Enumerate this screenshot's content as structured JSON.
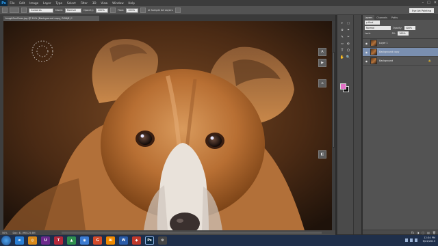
{
  "app": {
    "logo": "Ps",
    "menu": [
      "File",
      "Edit",
      "Image",
      "Layer",
      "Type",
      "Select",
      "Filter",
      "3D",
      "View",
      "Window",
      "Help"
    ],
    "window_controls": [
      "–",
      "□",
      "✕"
    ]
  },
  "options_bar": {
    "mode_value": "Contents",
    "opacity_label": "Mode:",
    "opacity_value": "Normal",
    "amount_label": "Opacity:",
    "amount_value": "100%",
    "flow_label": "Flow:",
    "flow_value": "100%",
    "sample_label": "Sample All Layers",
    "workspace": "Eye Art Painting"
  },
  "document": {
    "tab_title": "toughFoxClear.jpg @ 50% (Background copy, RGB/8) *",
    "zoom": "50%",
    "doc_size": "Doc: 41.9M/125.6M"
  },
  "float_buttons": [
    "A",
    "▶",
    "⌂",
    "◧"
  ],
  "tools": [
    "▸",
    "⬚",
    "ʘ",
    "⌖",
    "✎",
    "✂",
    "▭",
    "◐",
    "T",
    "⬠",
    "✋",
    "🔍"
  ],
  "colors": {
    "foreground": "#e36fc6",
    "background": "#111111"
  },
  "layers_panel": {
    "tabs": [
      "Layers",
      "Channels",
      "Paths"
    ],
    "kind": "ρ Kind",
    "blend_mode": "Normal",
    "opacity_label": "Opacity:",
    "opacity_value": "100%",
    "lock_label": "Lock:",
    "fill_label": "Fill:",
    "fill_value": "100%",
    "layers": [
      {
        "name": "Layer 1",
        "visible": true,
        "selected": false,
        "locked": false
      },
      {
        "name": "Background copy",
        "visible": true,
        "selected": true,
        "locked": false
      },
      {
        "name": "Background",
        "visible": true,
        "selected": false,
        "locked": true
      }
    ],
    "footer_icons": [
      "fx",
      "◑",
      "▢",
      "▤",
      "🗑"
    ]
  },
  "taskbar": {
    "apps": [
      {
        "label": "e",
        "color": "#2a7fd4"
      },
      {
        "label": "◎",
        "color": "#d98a1a"
      },
      {
        "label": "U",
        "color": "#6c2a8c"
      },
      {
        "label": "T",
        "color": "#b5283a"
      },
      {
        "label": "▲",
        "color": "#2f8f4f"
      },
      {
        "label": "◉",
        "color": "#3b7bd1"
      },
      {
        "label": "G",
        "color": "#d44a2a"
      },
      {
        "label": "Ai",
        "color": "#f08a00"
      },
      {
        "label": "W",
        "color": "#2a5ba8"
      },
      {
        "label": "◆",
        "color": "#c0392b"
      },
      {
        "label": "Ps",
        "color": "#0a2a44"
      },
      {
        "label": "⚙",
        "color": "#444444"
      }
    ],
    "time": "12:34 PM",
    "date": "6/22/2013"
  }
}
